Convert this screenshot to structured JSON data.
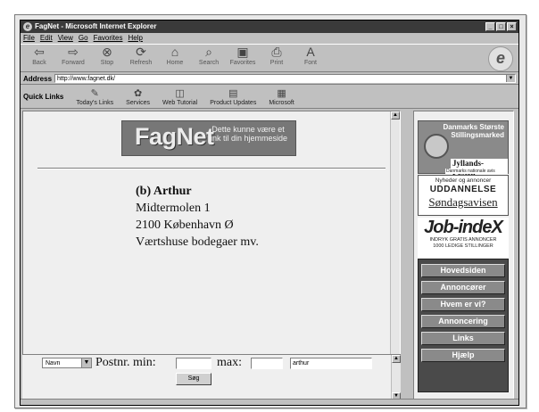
{
  "window": {
    "title": "FagNet - Microsoft Internet Explorer",
    "controls": [
      "_",
      "□",
      "×"
    ]
  },
  "menu": [
    "File",
    "Edit",
    "View",
    "Go",
    "Favorites",
    "Help"
  ],
  "toolbar": [
    {
      "label": "Back",
      "icon": "back-arrow-icon",
      "glyph": "⇦"
    },
    {
      "label": "Forward",
      "icon": "forward-arrow-icon",
      "glyph": "⇨"
    },
    {
      "label": "Stop",
      "icon": "stop-icon",
      "glyph": "⊗"
    },
    {
      "label": "Refresh",
      "icon": "refresh-icon",
      "glyph": "⟳"
    },
    {
      "label": "Home",
      "icon": "home-icon",
      "glyph": "⌂"
    },
    {
      "label": "Search",
      "icon": "search-icon",
      "glyph": "⌕"
    },
    {
      "label": "Favorites",
      "icon": "favorites-icon",
      "glyph": "▣"
    },
    {
      "label": "Print",
      "icon": "print-icon",
      "glyph": "⎙"
    },
    {
      "label": "Font",
      "icon": "font-icon",
      "glyph": "A"
    }
  ],
  "address": {
    "label": "Address",
    "url": "http://www.fagnet.dk/"
  },
  "quicklinks": {
    "label": "Quick Links",
    "items": [
      {
        "label": "Today's Links",
        "icon": "todays-links-icon",
        "glyph": "✎"
      },
      {
        "label": "Services",
        "icon": "services-icon",
        "glyph": "✿"
      },
      {
        "label": "Web Tutorial",
        "icon": "web-tutorial-icon",
        "glyph": "◫"
      },
      {
        "label": "Product Updates",
        "icon": "product-updates-icon",
        "glyph": "▤"
      },
      {
        "label": "Microsoft",
        "icon": "microsoft-icon",
        "glyph": "▦"
      }
    ]
  },
  "banner": {
    "logo": "FagNet",
    "tagline": "Dette kunne være et link til din hjemmeside"
  },
  "listing": {
    "name": "(b) Arthur",
    "street": "Midtermolen 1",
    "city": "2100 København Ø",
    "category": "Værtshuse bodegaer mv."
  },
  "search": {
    "field_select": "Navn",
    "postnr_label": "Postnr. min:",
    "min_value": "",
    "max_label": "max:",
    "max_value": "",
    "query": "arthur",
    "submit": "Søg"
  },
  "ads": {
    "jp_title": "Danmarks Største Stillingsmarked",
    "jp_brand": "Jyllands-Posten",
    "jp_sub": "Danmarks nationale avis",
    "education_top": "Nyheder og annoncer",
    "education_mid": "UDDANNELSE",
    "education_bottom": "Søndagsavisen",
    "jobindex_logo": "Job-indeX",
    "jobindex_line1": "INDRYK GRATIS ANNONCER",
    "jobindex_line2": "1000 LEDIGE STILLINGER"
  },
  "nav": [
    "Hovedsiden",
    "Annoncører",
    "Hvem er vi?",
    "Annoncering",
    "Links",
    "Hjælp"
  ]
}
